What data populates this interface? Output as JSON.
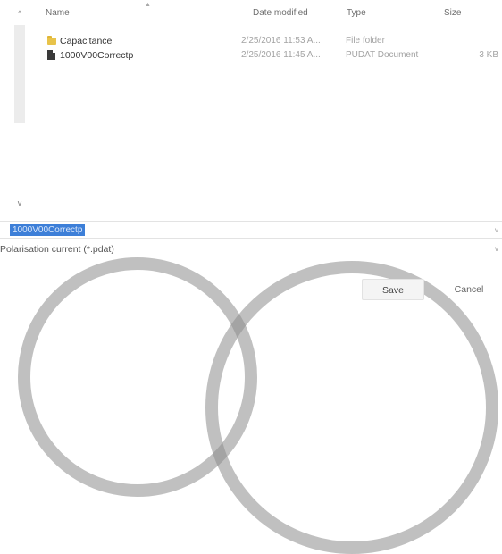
{
  "header": {
    "name": "Name",
    "date_modified": "Date modified",
    "type": "Type",
    "size": "Size"
  },
  "files": [
    {
      "name": "Capacitance",
      "date": "2/25/2016 11:53 A...",
      "type": "File folder",
      "size": "",
      "icon": "folder-icon"
    },
    {
      "name": "1000V00Correctp",
      "date": "2/25/2016 11:45 A...",
      "type": "PUDAT Document",
      "size": "3 KB",
      "icon": "file-icon"
    }
  ],
  "save_dialog": {
    "file_name_value": "1000V00Correctp",
    "file_type_value": "Polarisation current (*.pdat)",
    "save_label": "Save",
    "cancel_label": "Cancel"
  },
  "colors": {
    "selection": "#3d7fd8",
    "folder": "#e8c34a"
  }
}
